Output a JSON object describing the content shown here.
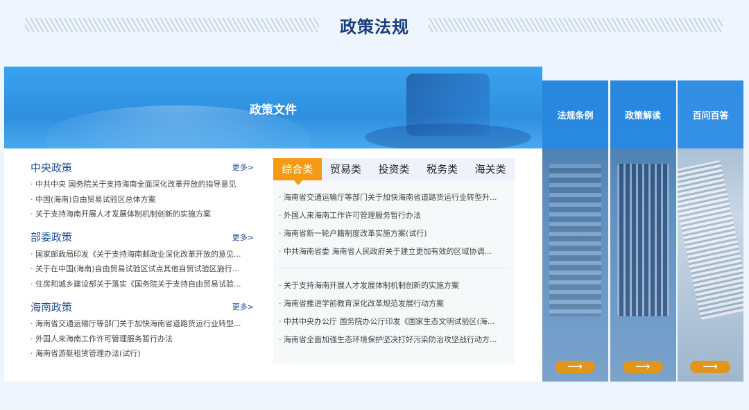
{
  "header": {
    "title": "政策法规"
  },
  "banner": {
    "title": "政策文件"
  },
  "policy_sections": [
    {
      "title": "中央政策",
      "more": "更多>",
      "items": [
        "中共中央 国务院关于支持海南全面深化改革开放的指导意见",
        "中国(海南)自由贸易试验区总体方案",
        "关于支持海南开展人才发展体制机制创新的实施方案"
      ]
    },
    {
      "title": "部委政策",
      "more": "更多>",
      "items": [
        "国家邮政局印发《关于支持海南邮政业深化改革开放的意见...",
        "关于在中国(海南)自由贸易试验区试点其他自贸试验区施行...",
        "住房和城乡建设部关于落实《国务院关于支持自由贸易试验..."
      ]
    },
    {
      "title": "海南政策",
      "more": "更多>",
      "items": [
        "海南省交通运输厅等部门关于加快海南省道路货运行业转型...",
        "外国人来海南工作许可管理服务暂行办法",
        "海南省游艇租赁管理办法(试行)"
      ]
    }
  ],
  "tabs": {
    "labels": [
      "综合类",
      "贸易类",
      "投资类",
      "税务类",
      "海关类"
    ],
    "active": 0,
    "group1": [
      "海南省交通运输厅等部门关于加快海南省道路货运行业转型升...",
      "外国人来海南工作许可管理服务暂行办法",
      "海南省新一轮户籍制度改革实施方案(试行)",
      "中共海南省委 海南省人民政府关于建立更加有效的区域协调..."
    ],
    "group2": [
      "关于支持海南开展人才发展体制机制创新的实施方案",
      "海南省推进学前教育深化改革规范发展行动方案",
      "中共中央办公厅 国务院办公厅印发《国家生态文明试验区(海...",
      "海南省全面加强生态环境保护坚决打好污染防治攻坚战行动方..."
    ]
  },
  "side_panels": [
    {
      "label": "法规条例",
      "arrow": "⟶"
    },
    {
      "label": "政策解读",
      "arrow": "⟶"
    },
    {
      "label": "百问百答",
      "arrow": "⟶"
    }
  ],
  "colors": {
    "accent_blue": "#2f8fe0",
    "title_navy": "#1b3d7a",
    "active_tab": "#f49a14",
    "arrow_orange": "#e2951c"
  },
  "icons": {
    "panel_arrow": "arrow-right-icon"
  }
}
